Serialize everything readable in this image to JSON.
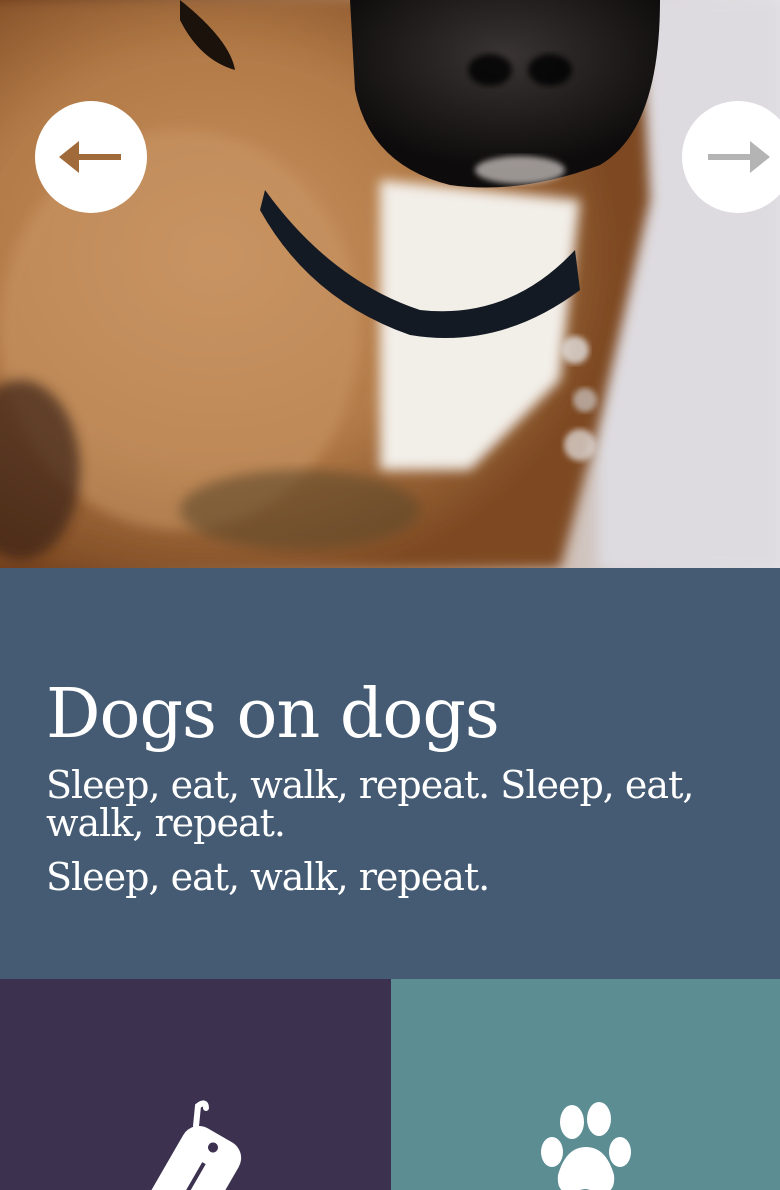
{
  "hero": {
    "image_description_icon": "dog-photo",
    "prev_icon": "arrow-left-icon",
    "next_icon": "arrow-right-icon"
  },
  "info": {
    "title": "Dogs on dogs",
    "subtitle_line1": "Sleep, eat, walk, repeat. Sleep, eat, walk, repeat.",
    "subtitle_line2": "Sleep, eat, walk, repeat."
  },
  "tiles": [
    {
      "icon": "dog-tag-icon",
      "color": "#3c3250"
    },
    {
      "icon": "paw-print-icon",
      "color": "#5b8d93"
    }
  ],
  "colors": {
    "info_background": "#455b73",
    "arrow_active": "#a06a3a",
    "arrow_inactive": "#b4b4b4"
  }
}
